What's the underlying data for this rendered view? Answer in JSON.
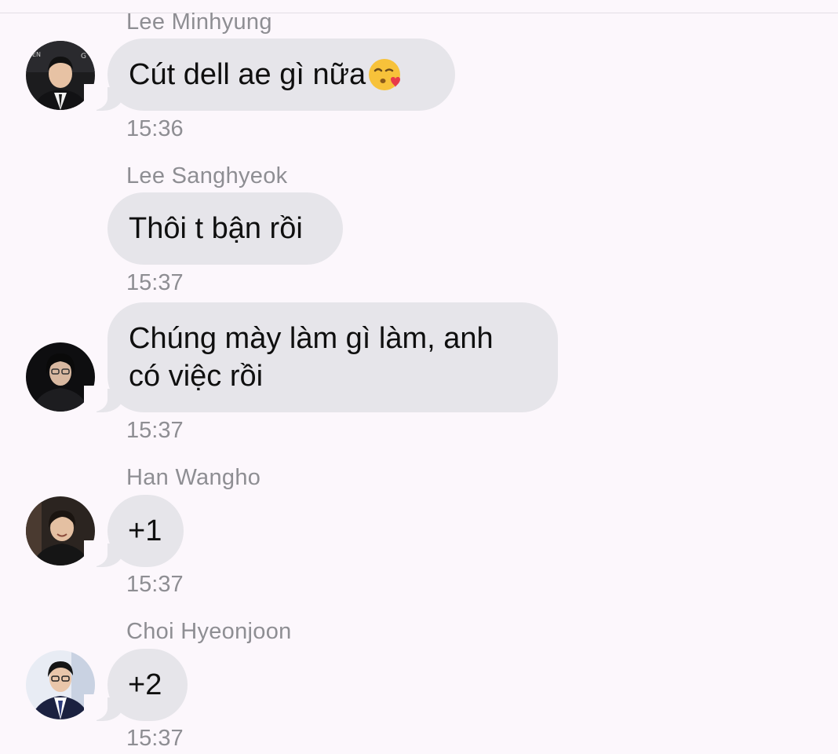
{
  "messages": [
    {
      "sender": "Lee Minhyung",
      "text": "Cút dell ae gì nữa",
      "emoji": "kissing-heart-emoji",
      "time": "15:36",
      "avatar": "avatar-lee-minhyung"
    },
    {
      "sender": "Lee Sanghyeok",
      "text": "Thôi t bận rồi",
      "time": "15:37",
      "avatar": null
    },
    {
      "sender": "",
      "lines": [
        "Chúng mày làm gì làm, anh",
        "có việc rồi"
      ],
      "time": "15:37",
      "avatar": "avatar-lee-sanghyeok"
    },
    {
      "sender": "Han Wangho",
      "text": "+1",
      "time": "15:37",
      "avatar": "avatar-han-wangho"
    },
    {
      "sender": "Choi Hyeonjoon",
      "text": "+2",
      "time": "15:37",
      "avatar": "avatar-choi-hyeonjoon"
    }
  ],
  "colors": {
    "background": "#fcf7fc",
    "bubble": "#e6e5ea",
    "meta_text": "#8e8e93",
    "message_text": "#0f0f0f"
  }
}
